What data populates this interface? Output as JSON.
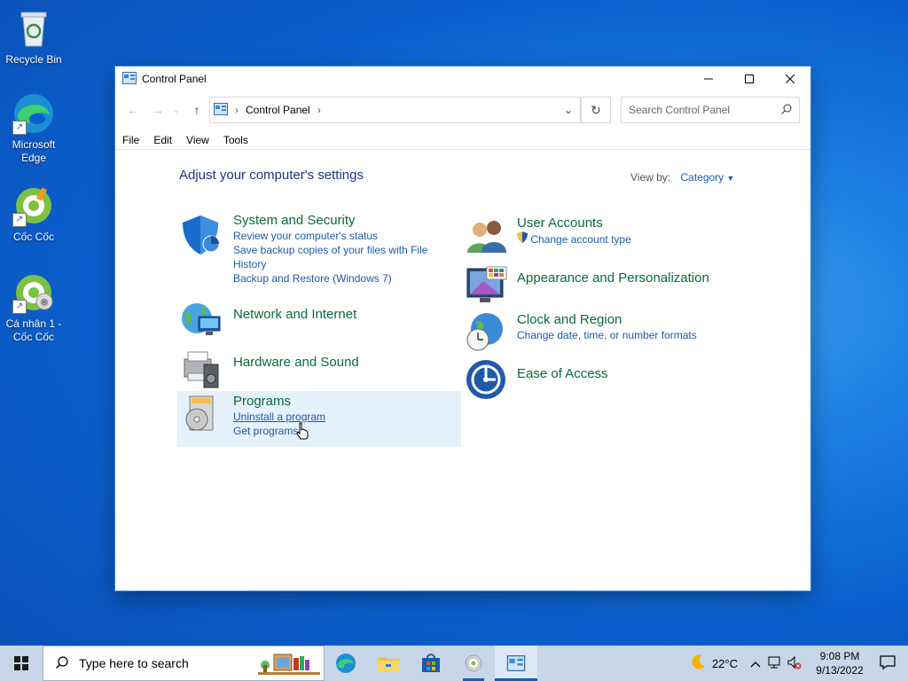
{
  "desktop": {
    "icons": [
      {
        "label": "Recycle Bin"
      },
      {
        "label": "Microsoft\nEdge"
      },
      {
        "label": "Cốc Cốc"
      },
      {
        "label": "Cá nhân 1 -\nCốc Cốc"
      }
    ]
  },
  "window": {
    "title": "Control Panel",
    "address": {
      "crumb": "Control Panel"
    },
    "search_placeholder": "Search Control Panel",
    "menu": [
      "File",
      "Edit",
      "View",
      "Tools"
    ]
  },
  "content": {
    "heading": "Adjust your computer's settings",
    "view_by_label": "View by:",
    "view_by_value": "Category",
    "categories": [
      {
        "title": "System and Security",
        "links": [
          "Review your computer's status",
          "Save backup copies of your files with File History",
          "Backup and Restore (Windows 7)"
        ]
      },
      {
        "title": "Network and Internet",
        "links": []
      },
      {
        "title": "Hardware and Sound",
        "links": []
      },
      {
        "title": "Programs",
        "links": [
          "Uninstall a program",
          "Get programs"
        ]
      },
      {
        "title": "User Accounts",
        "links": [
          "Change account type"
        ]
      },
      {
        "title": "Appearance and Personalization",
        "links": []
      },
      {
        "title": "Clock and Region",
        "links": [
          "Change date, time, or number formats"
        ]
      },
      {
        "title": "Ease of Access",
        "links": []
      }
    ]
  },
  "taskbar": {
    "search_placeholder": "Type here to search",
    "weather": "22°C",
    "time": "9:08 PM",
    "date": "9/13/2022"
  }
}
